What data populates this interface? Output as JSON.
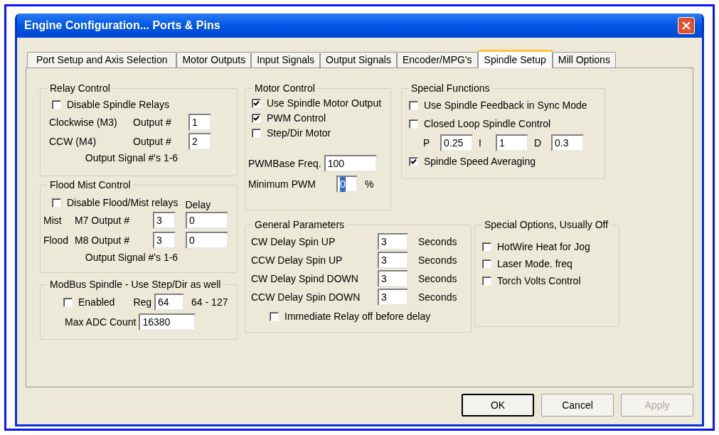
{
  "window": {
    "title": "Engine Configuration... Ports & Pins"
  },
  "tabs": [
    {
      "label": "Port Setup and Axis Selection",
      "selected": false
    },
    {
      "label": "Motor Outputs",
      "selected": false
    },
    {
      "label": "Input Signals",
      "selected": false
    },
    {
      "label": "Output Signals",
      "selected": false
    },
    {
      "label": "Encoder/MPG's",
      "selected": false
    },
    {
      "label": "Spindle Setup",
      "selected": true
    },
    {
      "label": "Mill Options",
      "selected": false
    }
  ],
  "relay_control": {
    "title": "Relay Control",
    "disable": {
      "label": "Disable Spindle Relays",
      "checked": false
    },
    "outputs": [
      {
        "label": "Clockwise (M3)",
        "output_label": "Output #",
        "value": "1"
      },
      {
        "label": "CCW (M4)",
        "output_label": "Output #",
        "value": "2"
      }
    ],
    "note": "Output Signal #'s 1-6"
  },
  "flood_mist_control": {
    "title": "Flood Mist Control",
    "disable": {
      "label": "Disable Flood/Mist relays",
      "checked": false
    },
    "delay_label": "Delay",
    "outputs": [
      {
        "label": "Mist",
        "output_label": "M7 Output #",
        "value": "3",
        "delay": "0"
      },
      {
        "label": "Flood",
        "output_label": "M8 Output #",
        "value": "3",
        "delay": "0"
      }
    ],
    "note": "Output Signal #'s 1-6"
  },
  "modbus_spindle": {
    "title": "ModBus Spindle - Use Step/Dir as well",
    "enabled": {
      "label": "Enabled",
      "checked": false
    },
    "reg_label": "Reg",
    "reg_value": "64",
    "reg_range": "64 - 127",
    "max_adc_label": "Max ADC Count",
    "max_adc_value": "16380"
  },
  "motor_control": {
    "title": "Motor Control",
    "options": [
      {
        "label": "Use Spindle Motor Output",
        "checked": true
      },
      {
        "label": "PWM Control",
        "checked": true
      },
      {
        "label": "Step/Dir Motor",
        "checked": false
      }
    ],
    "pwm_base_label": "PWMBase Freq.",
    "pwm_base_value": "100",
    "min_pwm_label": "Minimum PWM",
    "min_pwm_value": "0",
    "min_pwm_text_selected": true,
    "min_pwm_unit": "%"
  },
  "special_functions": {
    "title": "Special Functions",
    "options": [
      {
        "label": "Use Spindle Feedback in Sync Mode",
        "checked": false
      },
      {
        "label": "Closed Loop Spindle Control",
        "checked": false
      }
    ],
    "pid": [
      {
        "label": "P",
        "value": "0.25"
      },
      {
        "label": "I",
        "value": "1"
      },
      {
        "label": "D",
        "value": "0.3"
      }
    ],
    "averaging": {
      "label": "Spindle Speed Averaging",
      "checked": true
    }
  },
  "general_parameters": {
    "title": "General Parameters",
    "delays": [
      {
        "label": "CW Delay Spin UP",
        "value": "3",
        "unit": "Seconds"
      },
      {
        "label": "CCW Delay Spin UP",
        "value": "3",
        "unit": "Seconds"
      },
      {
        "label": "CW Delay Spind DOWN",
        "value": "3",
        "unit": "Seconds"
      },
      {
        "label": "CCW Delay Spin DOWN",
        "value": "3",
        "unit": "Seconds"
      }
    ],
    "immediate_relay_off": {
      "label": "Immediate Relay off before delay",
      "checked": false
    }
  },
  "special_options": {
    "title": "Special Options, Usually Off",
    "options": [
      {
        "label": "HotWire Heat for Jog",
        "checked": false
      },
      {
        "label": "Laser Mode. freq",
        "checked": false
      },
      {
        "label": "Torch Volts Control",
        "checked": false
      }
    ]
  },
  "buttons": [
    {
      "label": "OK",
      "default": true,
      "disabled": false
    },
    {
      "label": "Cancel",
      "default": false,
      "disabled": false
    },
    {
      "label": "Apply",
      "default": false,
      "disabled": true
    }
  ]
}
